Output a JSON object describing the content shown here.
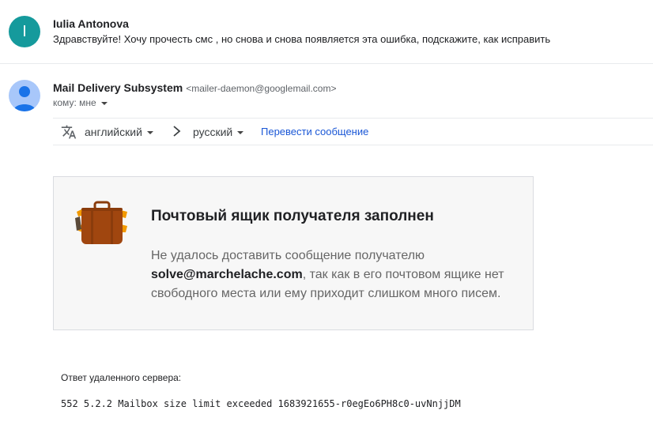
{
  "message1": {
    "avatar_letter": "I",
    "sender": "Iulia Antonova",
    "snippet": "Здравствуйте! Хочу прочесть смс , но снова и снова появляется эта ошибка, подскажите, как исправить"
  },
  "message2": {
    "sender_name": "Mail Delivery Subsystem",
    "sender_email": "<mailer-daemon@googlemail.com>",
    "to_line": "кому: мне"
  },
  "translate": {
    "from_lang": "английский",
    "to_lang": "русский",
    "action": "Перевести сообщение"
  },
  "card": {
    "title": "Почтовый ящик получателя заполнен",
    "body_prefix": "Не удалось доставить сообщение получателю",
    "recipient": "solve@marchelache.com",
    "body_suffix": ", так как в его почтовом ящике нет свободного места или ему приходит слишком много писем."
  },
  "remote": {
    "label": "Ответ удаленного сервера:",
    "text": "552 5.2.2 Mailbox size limit exceeded 1683921655-r0egEo6PH8c0-uvNnjjDM"
  },
  "colors": {
    "avatar1": "#159a9c",
    "avatar2": "#a8c7fa",
    "link": "#1a57d6",
    "briefcase": "#a0460f",
    "briefcase_accent": "#f29900"
  },
  "icons": {
    "translate": "translate-icon",
    "arrow": "chevron-right-icon",
    "briefcase": "briefcase-icon",
    "avatar2": "person-icon"
  }
}
